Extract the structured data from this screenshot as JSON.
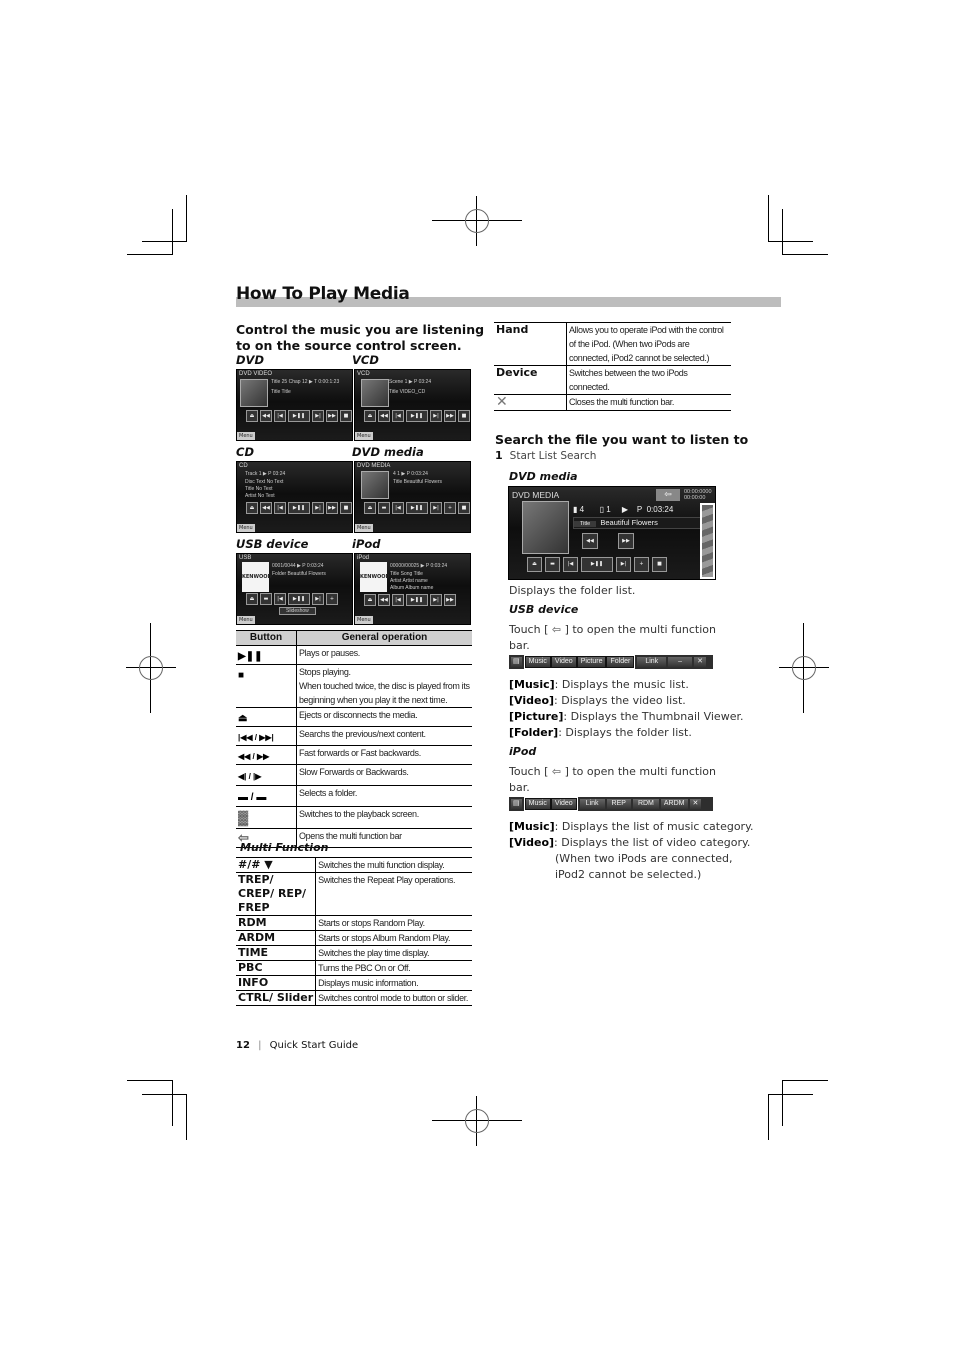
{
  "page": {
    "title": "How To Play Media",
    "footer": {
      "page_number": "12",
      "guide_label": "Quick Start Guide"
    }
  },
  "left": {
    "heading_line1": "Control the music you are listening",
    "heading_line2": "to on the source control screen.",
    "screens": [
      {
        "label": "DVD",
        "header": "DVD VIDEO",
        "line1": "Title 25  Chap 12  ▶  T 0:00:1:23",
        "line2": "Title   Title",
        "menu": "Menu"
      },
      {
        "label": "VCD",
        "header": "VCD",
        "line1": "Scene 1   ▶   P 03:24",
        "line2": "Title   VIDEO_CD",
        "menu": "Menu"
      },
      {
        "label": "CD",
        "header": "CD",
        "line1": "Track 1   ▶   P 03:24",
        "line2": "Disc Text  No Text",
        "line3": "Title  No Text",
        "line4": "Artist  No Text",
        "menu": "Menu"
      },
      {
        "label": "DVD media",
        "header": "DVD MEDIA",
        "line1": "4   1   ▶   P 0:03:24",
        "line2": "Title  Beautiful Flowers",
        "menu": "Menu"
      },
      {
        "label": "USB device",
        "header": "USB",
        "line1": "0001/0044   ▶   P 0:03:24",
        "line2": "Folder  Beautiful Flowers",
        "extra": "Slideshow",
        "logo": "KENWOOD",
        "menu": "Menu"
      },
      {
        "label": "iPod",
        "header": "iPod",
        "line1": "00000/00025   ▶   P 0:03:24",
        "line2": "Title  Song Title",
        "line3": "Artist  Artist name",
        "line4": "Album  Album name",
        "logo": "KENWOOD",
        "menu": "Menu"
      }
    ],
    "button_table": {
      "headers": [
        "Button",
        "General operation"
      ],
      "rows": [
        {
          "icon": "play-pause-icon",
          "glyph": "▶❚❚",
          "desc": "Plays or pauses."
        },
        {
          "icon": "stop-icon",
          "glyph": "■",
          "desc": "Stops playing.\nWhen touched twice, the disc is played from its beginning when you play it the next time."
        },
        {
          "icon": "eject-icon",
          "glyph": "⏏",
          "desc": "Ejects or disconnects the media."
        },
        {
          "icon": "prev-next-icon",
          "glyph": "|◀◀ / ▶▶|",
          "desc": "Searchs the previous/next content."
        },
        {
          "icon": "fast-rewind-forward-icon",
          "glyph": "◀◀ / ▶▶",
          "desc": "Fast forwards or Fast backwards."
        },
        {
          "icon": "slow-back-forward-icon",
          "glyph": "◀| / |▶",
          "desc": "Slow Forwards or Backwards."
        },
        {
          "icon": "folder-icon",
          "glyph": "▬ / ▬",
          "desc": "Selects a folder."
        },
        {
          "icon": "clapperboard-icon",
          "glyph": "▓",
          "desc": "Switches to the playback screen."
        },
        {
          "icon": "back-arrow-icon",
          "glyph": "⇦",
          "desc": "Opens the multi function bar"
        }
      ]
    },
    "multi_function": {
      "label": "Multi Function",
      "rows": [
        {
          "key": "#/# ▼",
          "desc": "Switches the multi function display."
        },
        {
          "key": "TREP/ CREP/ REP/ FREP",
          "desc": "Switches the Repeat Play operations."
        },
        {
          "key": "RDM",
          "desc": "Starts or stops Random Play."
        },
        {
          "key": "ARDM",
          "desc": "Starts or stops Album Random Play."
        },
        {
          "key": "TIME",
          "desc": "Switches the play time display."
        },
        {
          "key": "PBC",
          "desc": "Turns the PBC On or Off."
        },
        {
          "key": "INFO",
          "desc": "Displays music information."
        },
        {
          "key": "CTRL/ Slider",
          "desc": "Switches control mode to button or slider."
        }
      ]
    }
  },
  "right": {
    "top_table": [
      {
        "key": "Hand",
        "desc": "Allows you to operate iPod with the control of the iPod. (When two iPods are connected, iPod2 cannot be selected.)"
      },
      {
        "key": "Device",
        "desc": "Switches between the two iPods connected."
      },
      {
        "key": "close-icon",
        "desc": "Closes the multi function bar."
      }
    ],
    "search_heading": "Search the file you want to listen to",
    "step_number": "1",
    "step_text": "Start List Search",
    "dvd_media_label": "DVD media",
    "dvd_screen": {
      "header": "DVD MEDIA",
      "time_top": "00:00:0000",
      "time_bottom": "00:00:00",
      "folder": "4",
      "file": "1",
      "play_mode": "P",
      "time": "0:03:24",
      "title_tag": "Title",
      "title": "Beautiful Flowers"
    },
    "dvd_caption": "Displays the folder list.",
    "usb_label": "USB device",
    "touch_text_pre": "Touch [",
    "touch_text_post": "] to open the multi function bar.",
    "usb_bar": {
      "group": [
        "Music",
        "Video",
        "Picture",
        "Folder"
      ],
      "others": [
        "Link",
        "–"
      ]
    },
    "usb_items": [
      {
        "key": "[Music]",
        "desc": ": Displays the music list."
      },
      {
        "key": "[Video]",
        "desc": ": Displays the video list."
      },
      {
        "key": "[Picture]",
        "desc": ": Displays the Thumbnail Viewer."
      },
      {
        "key": "[Folder]",
        "desc": ": Displays the folder list."
      }
    ],
    "ipod_label": "iPod",
    "ipod_bar": {
      "group": [
        "Music",
        "Video"
      ],
      "others": [
        "Link",
        "REP",
        "RDM",
        "ARDM"
      ]
    },
    "ipod_items": [
      {
        "key": "[Music]",
        "desc": ": Displays the list of music category."
      },
      {
        "key": "[Video]",
        "desc": ": Displays the list of video category."
      }
    ],
    "ipod_note": "(When two iPods are connected, iPod2 cannot be selected.)"
  }
}
